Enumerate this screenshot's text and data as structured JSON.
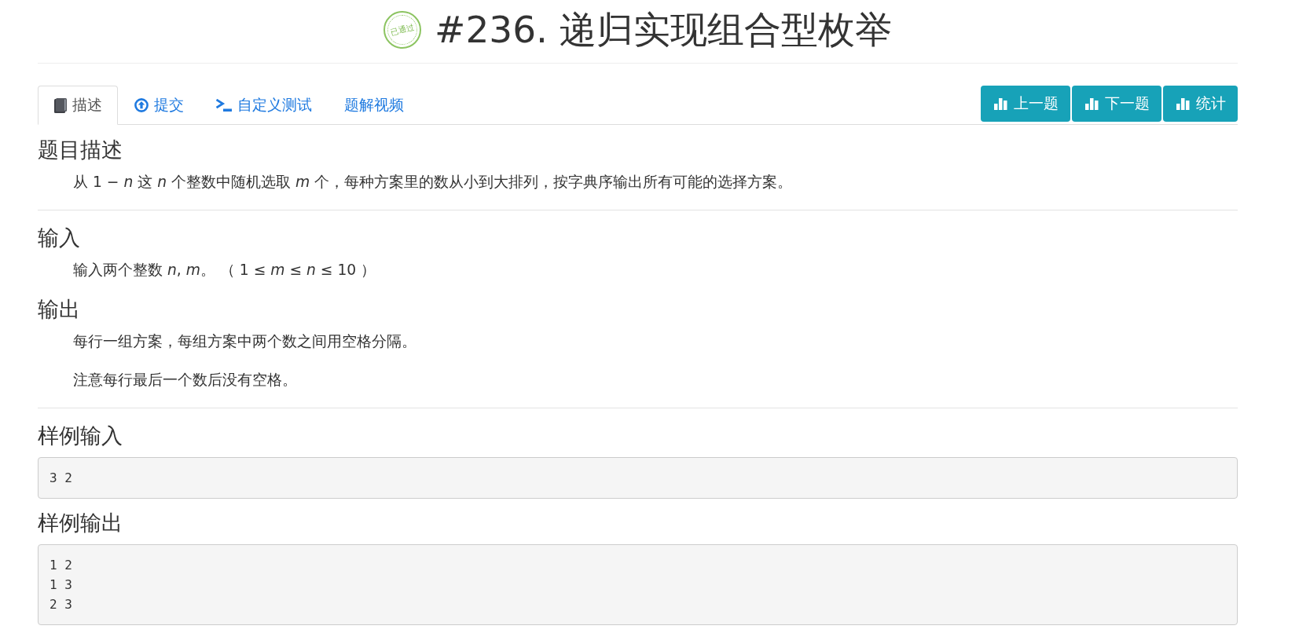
{
  "title": {
    "badge": "已通过",
    "text": "#236. 递归实现组合型枚举"
  },
  "tabs": [
    {
      "label": "描述",
      "selected": true
    },
    {
      "label": "提交",
      "selected": false
    },
    {
      "label": "自定义测试",
      "selected": false
    },
    {
      "label": "题解视频",
      "selected": false
    }
  ],
  "actions": [
    {
      "label": "上一题"
    },
    {
      "label": "下一题"
    },
    {
      "label": "统计"
    }
  ],
  "blocks": [
    {
      "sections": [
        {
          "kind": "text",
          "heading": "题目描述",
          "paragraphs": [
            "从 1 − *n* 这 *n* 个整数中随机选取 *m* 个，每种方案里的数从小到大排列，按字典序输出所有可能的选择方案。"
          ]
        }
      ]
    },
    {
      "sections": [
        {
          "kind": "text",
          "heading": "输入",
          "paragraphs": [
            "输入两个整数 *n*, *m*。 （ 1 ≤ *m* ≤ *n* ≤ 10 ）"
          ]
        },
        {
          "kind": "text",
          "heading": "输出",
          "paragraphs": [
            "每行一组方案，每组方案中两个数之间用空格分隔。",
            "注意每行最后一个数后没有空格。"
          ]
        }
      ]
    },
    {
      "sections": [
        {
          "kind": "code",
          "heading": "样例输入",
          "code": "3 2"
        },
        {
          "kind": "code",
          "heading": "样例输出",
          "code": "1 2\n1 3\n2 3"
        }
      ]
    }
  ]
}
